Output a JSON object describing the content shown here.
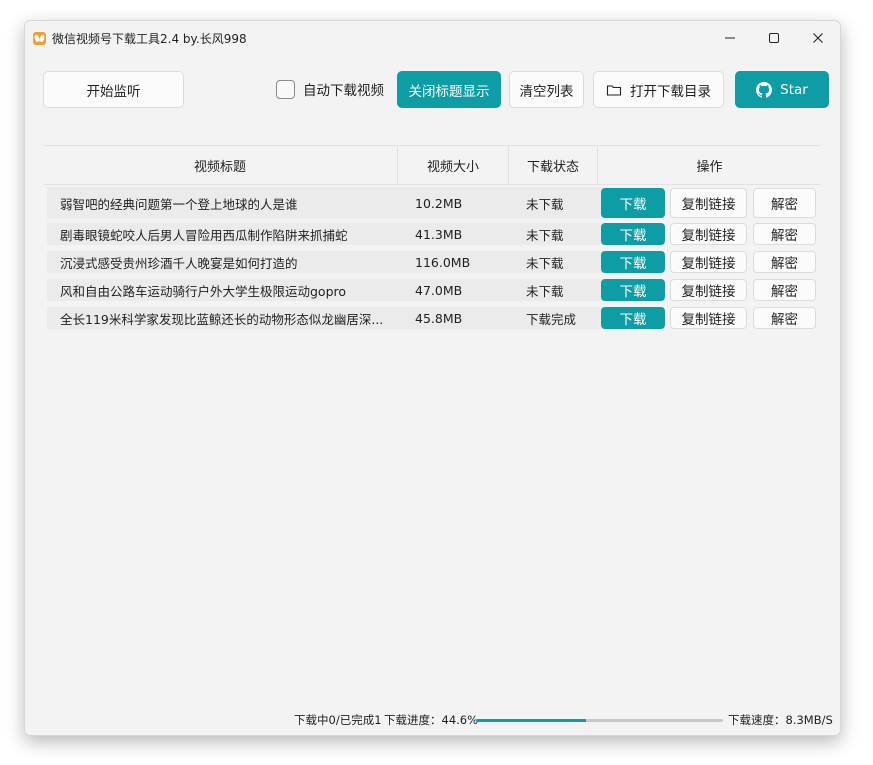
{
  "window": {
    "title": "微信视频号下载工具2.4 by.长风998",
    "controls": [
      "minimize-icon",
      "maximize-icon",
      "close-icon"
    ]
  },
  "toolbar": {
    "start_label": "开始监听",
    "auto_download_label": "自动下载视频",
    "auto_download_checked": false,
    "toggle_title_label": "关闭标题显示",
    "clear_label": "清空列表",
    "open_dir_label": "打开下载目录",
    "star_label": "Star"
  },
  "table": {
    "headers": [
      "视频标题",
      "视频大小",
      "下载状态",
      "操作"
    ],
    "rows": [
      {
        "title": "弱智吧的经典问题第一个登上地球的人是谁",
        "size": "10.2MB",
        "status": "未下载",
        "download": "下载",
        "copy": "复制链接",
        "decrypt": "解密"
      },
      {
        "title": "剧毒眼镜蛇咬人后男人冒险用西瓜制作陷阱来抓捕蛇",
        "size": "41.3MB",
        "status": "未下载",
        "download": "下载",
        "copy": "复制链接",
        "decrypt": "解密"
      },
      {
        "title": "沉浸式感受贵州珍酒千人晚宴是如何打造的",
        "size": "116.0MB",
        "status": "未下载",
        "download": "下载",
        "copy": "复制链接",
        "decrypt": "解密"
      },
      {
        "title": "风和自由公路车运动骑行户外大学生极限运动gopro",
        "size": "47.0MB",
        "status": "未下载",
        "download": "下载",
        "copy": "复制链接",
        "decrypt": "解密"
      },
      {
        "title": "全长119米科学家发现比蓝鲸还长的动物形态似龙幽居深...",
        "size": "45.8MB",
        "status": "下载完成",
        "download": "下载",
        "copy": "复制链接",
        "decrypt": "解密"
      }
    ]
  },
  "status": {
    "counts": "下载中0/已完成1",
    "progress_label": "下载进度：44.6%",
    "progress_fraction": 0.446,
    "speed": "下载速度：8.3MB/S"
  },
  "colors": {
    "accent": "#0e9da4",
    "window_bg": "#f3f3f3"
  }
}
